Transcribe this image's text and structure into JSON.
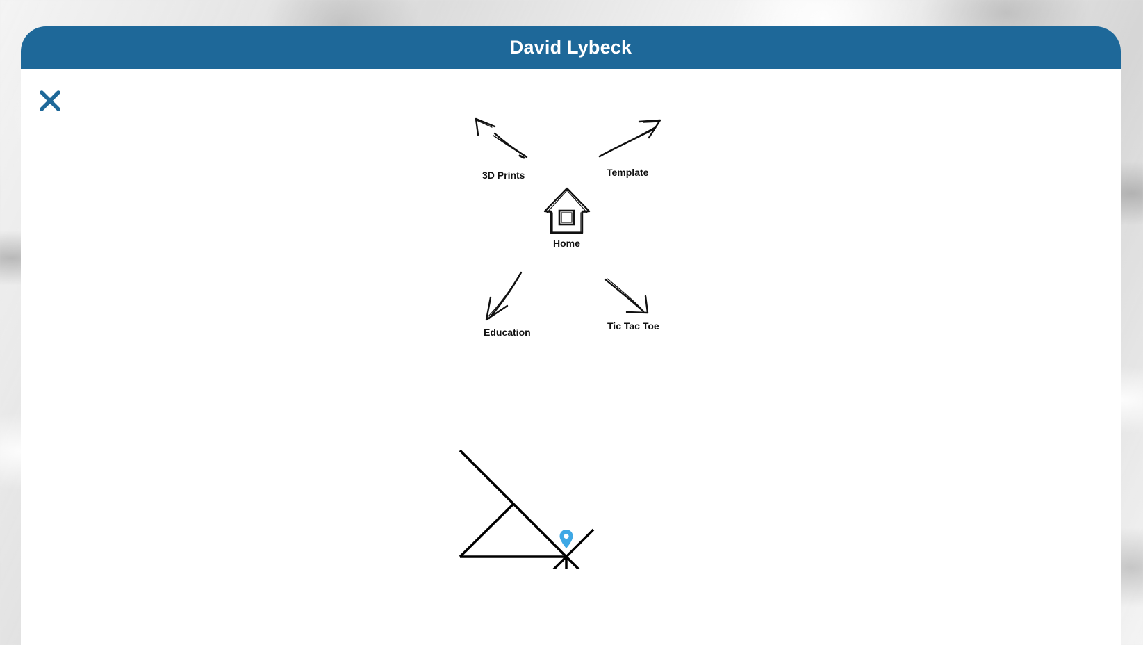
{
  "header": {
    "title": "David Lybeck"
  },
  "close": {
    "icon": "close-icon",
    "color": "#1e6899"
  },
  "nav": {
    "items": [
      {
        "id": "3d-prints",
        "label": "3D Prints",
        "icon": "arrow-up-left-icon"
      },
      {
        "id": "template",
        "label": "Template",
        "icon": "arrow-up-right-icon"
      },
      {
        "id": "home",
        "label": "Home",
        "icon": "house-icon"
      },
      {
        "id": "education",
        "label": "Education",
        "icon": "arrow-down-left-icon"
      },
      {
        "id": "tic-tac-toe",
        "label": "Tic Tac Toe",
        "icon": "arrow-down-right-icon"
      }
    ]
  },
  "map": {
    "icon": "map-pin-icon",
    "pin_color": "#3ea8e5"
  },
  "colors": {
    "accent": "#1e6899",
    "background": "#ffffff"
  }
}
